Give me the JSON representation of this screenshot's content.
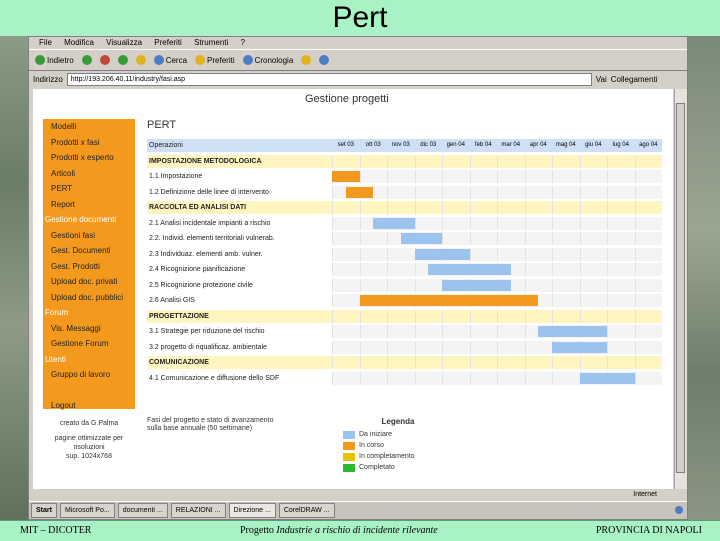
{
  "slide": {
    "title": "Pert",
    "footer_left": "MIT – DICOTER",
    "footer_center_prefix": "Progetto ",
    "footer_center_italic": "Industrie a rischio di incidente rilevante",
    "footer_right": "PROVINCIA DI NAPOLI"
  },
  "browser": {
    "menu": [
      "File",
      "Modifica",
      "Visualizza",
      "Preferiti",
      "Strumenti",
      "?"
    ],
    "toolbar": {
      "back": "Indietro",
      "search": "Cerca",
      "favorites": "Preferiti",
      "history": "Cronologia"
    },
    "address_label": "Indirizzo",
    "address_value": "http://193.206.40.11/industry/fasi.asp",
    "go_label": "Vai",
    "links_label": "Collegamenti",
    "status_zone": "Internet",
    "taskbar": [
      "Start",
      "Microsoft Po...",
      "documenti ...",
      "RELAZIONI ...",
      "Direzione ...",
      "CorelDRAW ..."
    ],
    "colors": {
      "accent": "#f39a1e",
      "title_bg": "#a8f2c6"
    }
  },
  "page": {
    "heading": "Gestione progetti",
    "pert_label": "PERT",
    "sidebar": [
      {
        "label": "Modelli",
        "section": false
      },
      {
        "label": "Prodotti x fasi",
        "section": false
      },
      {
        "label": "Prodotti x esperto",
        "section": false
      },
      {
        "label": "Articoli",
        "section": false
      },
      {
        "label": "PERT",
        "section": false
      },
      {
        "label": "Report",
        "section": false
      },
      {
        "label": "Gestione documenti",
        "section": true
      },
      {
        "label": "Gestioni fasi",
        "section": false
      },
      {
        "label": "Gest. Documenti",
        "section": false
      },
      {
        "label": "Gest. Prodotti",
        "section": false
      },
      {
        "label": "Upload doc. privati",
        "section": false
      },
      {
        "label": "Upload doc. pubblici",
        "section": false
      },
      {
        "label": "Forum",
        "section": true
      },
      {
        "label": "Vis. Messaggi",
        "section": false
      },
      {
        "label": "Gestione Forum",
        "section": false
      },
      {
        "label": "Utenti",
        "section": true
      },
      {
        "label": "Gruppo di lavoro",
        "section": false
      },
      {
        "label": "",
        "section": false
      },
      {
        "label": "Logout",
        "section": false
      }
    ],
    "sidebar_note_1": "creato da G.Palma",
    "sidebar_note_2": "pagine ottimizzate per risoluzioni",
    "sidebar_note_3": "sup. 1024x768",
    "gantt_header": "Operazioni",
    "months": [
      "set 03",
      "ott 03",
      "nov 03",
      "dic 03",
      "gen 04",
      "feb 04",
      "mar 04",
      "apr 04",
      "mag 04",
      "giu 04",
      "lug 04",
      "ago 04"
    ],
    "rows": [
      {
        "label": "IMPOSTAZIONE METODOLOGICA",
        "section": true,
        "start": 0,
        "end": 0,
        "status": ""
      },
      {
        "label": "1.1 Impostazione",
        "section": false,
        "start": 0,
        "end": 1,
        "status": "in_corso"
      },
      {
        "label": "1.2 Definizione delle linee di intervento",
        "section": false,
        "start": 0.5,
        "end": 1.5,
        "status": "in_corso"
      },
      {
        "label": "RACCOLTA ED ANALISI DATI",
        "section": true,
        "start": 0,
        "end": 0,
        "status": ""
      },
      {
        "label": "2.1 Analisi incidentale impianti a rischio",
        "section": false,
        "start": 1.5,
        "end": 3,
        "status": "da_iniziare"
      },
      {
        "label": "2.2. Individ. elementi territoriali vulnerab.",
        "section": false,
        "start": 2.5,
        "end": 4,
        "status": "da_iniziare"
      },
      {
        "label": "2.3 Individuaz. elementi amb. vulner.",
        "section": false,
        "start": 3,
        "end": 5,
        "status": "da_iniziare"
      },
      {
        "label": "2.4 Ricognizione pianificazione",
        "section": false,
        "start": 3.5,
        "end": 6.5,
        "status": "da_iniziare"
      },
      {
        "label": "2.5 Ricognizione protezione civile",
        "section": false,
        "start": 4,
        "end": 6.5,
        "status": "da_iniziare"
      },
      {
        "label": "2.6 Analisi GIS",
        "section": false,
        "start": 1,
        "end": 7.5,
        "status": "in_corso"
      },
      {
        "label": "PROGETTAZIONE",
        "section": true,
        "start": 0,
        "end": 0,
        "status": ""
      },
      {
        "label": "3.1 Strategie per riduzione del rischio",
        "section": false,
        "start": 7.5,
        "end": 10,
        "status": "da_iniziare"
      },
      {
        "label": "3.2 progetto di riqualificaz. ambientale",
        "section": false,
        "start": 8,
        "end": 10,
        "status": "da_iniziare"
      },
      {
        "label": "COMUNICAZIONE",
        "section": true,
        "start": 0,
        "end": 0,
        "status": ""
      },
      {
        "label": "4.1 Comunicazione e diffusione dello SDF",
        "section": false,
        "start": 9,
        "end": 11,
        "status": "da_iniziare"
      }
    ],
    "legend_note": "Fasi del progetto e stato di avanzamento sulla base annuale (50 settimane)",
    "legend": {
      "title": "Legenda",
      "items": [
        {
          "label": "Da iniziare",
          "color": "#9cc3ee"
        },
        {
          "label": "In corso",
          "color": "#f39a1e"
        },
        {
          "label": "In completamento",
          "color": "#e8c400"
        },
        {
          "label": "Completato",
          "color": "#2db82d"
        }
      ]
    }
  }
}
